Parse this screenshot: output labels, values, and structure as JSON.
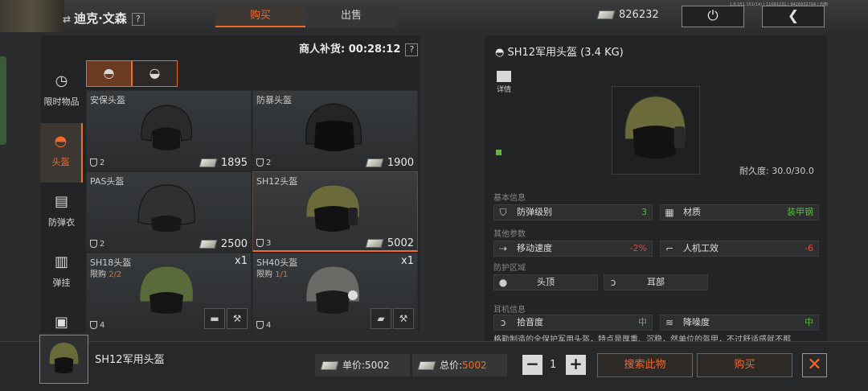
{
  "player": {
    "name": "迪克·文森",
    "switch_icon": "⇄",
    "help": "?"
  },
  "tabs": {
    "buy": "购买",
    "sell": "出售"
  },
  "money": "826232",
  "version": "1.0.151.151(14) | 11091231 | 9426932794 | 均衡",
  "restock": {
    "label": "商人补货: 00:28:12",
    "help": "?"
  },
  "categories": [
    {
      "label": "限时物品",
      "icon": "clock-icon"
    },
    {
      "label": "头盔",
      "icon": "helmet-icon"
    },
    {
      "label": "防弹衣",
      "icon": "vest-icon"
    },
    {
      "label": "弹挂",
      "icon": "rig-icon"
    }
  ],
  "items": [
    {
      "name": "安保头盔",
      "level": "2",
      "price": "1895"
    },
    {
      "name": "防暴头盔",
      "level": "2",
      "price": "1900"
    },
    {
      "name": "PAS头盔",
      "level": "2",
      "price": "2500"
    },
    {
      "name": "SH12头盔",
      "level": "3",
      "price": "5002"
    },
    {
      "name": "SH18头盔",
      "level": "4",
      "limit_label": "限购",
      "limit": "2/2",
      "qty": "x1"
    },
    {
      "name": "SH40头盔",
      "level": "4",
      "limit_label": "限购",
      "limit": "1/1",
      "qty": "x1"
    }
  ],
  "detail": {
    "title": "SH12军用头盔 (3.4 KG)",
    "details_label": "详情",
    "durability": "耐久度: 30.0/30.0",
    "sections": {
      "basic": "基本信息",
      "other": "其他参数",
      "protect": "防护区域",
      "headset": "耳机信息"
    },
    "basic": [
      {
        "label": "防弹级别",
        "value": "3"
      },
      {
        "label": "材质",
        "value": "装甲钢"
      }
    ],
    "other": [
      {
        "label": "移动速度",
        "value": "-2%"
      },
      {
        "label": "人机工效",
        "value": "-6"
      }
    ],
    "protect": [
      {
        "label": "头顶"
      },
      {
        "label": "耳部"
      }
    ],
    "headset": [
      {
        "label": "拾音度",
        "value": "中"
      },
      {
        "label": "降噪度",
        "value": "中"
      }
    ],
    "desc": "格勒制造的全保护军用头盔，特点是厚重、沉稳，然单位的盔甲，不过舒适感就不那"
  },
  "bottom": {
    "name": "SH12军用头盔",
    "unit_label": "单价:",
    "unit_price": "5002",
    "total_label": "总价:",
    "total_price": "5002",
    "qty": "1",
    "search_label": "搜索此物",
    "buy_label": "购买",
    "close": "✕"
  },
  "colors": {
    "accent": "#f06a2a",
    "green": "#5dba3e",
    "red": "#e04a3a"
  }
}
